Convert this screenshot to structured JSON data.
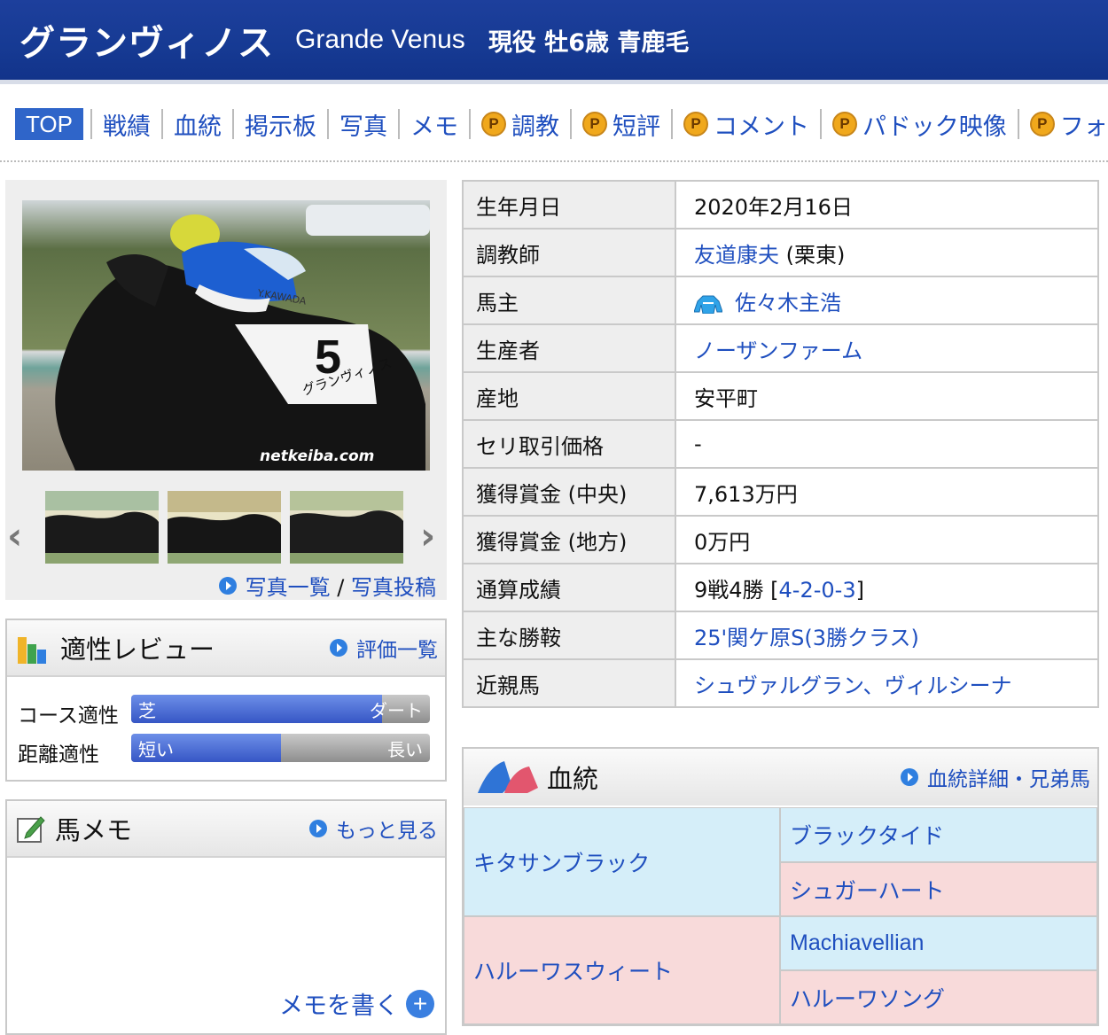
{
  "header": {
    "name_ja": "グランヴィノス",
    "name_en": "Grande Venus",
    "profile": "現役 牡6歳 青鹿毛"
  },
  "tabs": [
    {
      "label": "TOP",
      "premium": false
    },
    {
      "label": "戦績",
      "premium": false
    },
    {
      "label": "血統",
      "premium": false
    },
    {
      "label": "掲示板",
      "premium": false
    },
    {
      "label": "写真",
      "premium": false
    },
    {
      "label": "メモ",
      "premium": false
    },
    {
      "label": "調教",
      "premium": true
    },
    {
      "label": "短評",
      "premium": true
    },
    {
      "label": "コメント",
      "premium": true
    },
    {
      "label": "パドック映像",
      "premium": true
    },
    {
      "label": "フォトパ",
      "premium": true
    }
  ],
  "premium_badge": "P",
  "photo": {
    "watermark": "netkeiba.com",
    "saddle_number": "5",
    "saddle_name": "グランヴィノス",
    "jockey_tag": "Y.KAWADA",
    "links": {
      "list": "写真一覧",
      "separator": "/",
      "post": "写真投稿"
    }
  },
  "aptitude": {
    "title": "適性レビュー",
    "link": "評価一覧",
    "course_label": "コース適性",
    "course_left": "芝",
    "course_right": "ダート",
    "course_value": 0.84,
    "distance_label": "距離適性",
    "distance_left": "短い",
    "distance_right": "長い",
    "distance_value": 0.5
  },
  "memo": {
    "title": "馬メモ",
    "link": "もっと見る",
    "write": "メモを書く",
    "plus": "+"
  },
  "profile_table": [
    {
      "key": "生年月日",
      "value": "2020年2月16日"
    },
    {
      "key": "調教師",
      "value": "友道康夫",
      "suffix": " (栗東)"
    },
    {
      "key": "馬主",
      "value": "佐々木主浩"
    },
    {
      "key": "生産者",
      "value": "ノーザンファーム"
    },
    {
      "key": "産地",
      "value": "安平町"
    },
    {
      "key": "セリ取引価格",
      "value": "-"
    },
    {
      "key": "獲得賞金 (中央)",
      "value": "7,613万円"
    },
    {
      "key": "獲得賞金 (地方)",
      "value": "0万円"
    },
    {
      "key": "通算成績",
      "value": "9戦4勝 [",
      "record": "4-2-0-3",
      "close": "]"
    },
    {
      "key": "主な勝鞍",
      "value": "25'関ケ原S(3勝クラス)"
    },
    {
      "key": "近親馬",
      "value": "シュヴァルグラン、ヴィルシーナ"
    }
  ],
  "pedigree": {
    "title": "血統",
    "link": "血統詳細・兄弟馬",
    "sire": "キタサンブラック",
    "dam": "ハルーワスウィート",
    "sire_sire": "ブラックタイド",
    "sire_dam": "シュガーハート",
    "dam_sire": "Machiavellian",
    "dam_dam": "ハルーワソング"
  },
  "colors": {
    "header": "#163a93",
    "link": "#1f4fbf",
    "male": "#d5eef9",
    "female": "#f8dada",
    "premium": "#f0a81c"
  }
}
